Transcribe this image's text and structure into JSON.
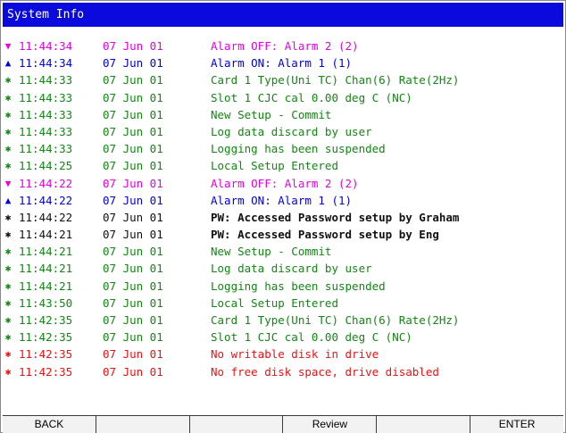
{
  "window": {
    "title": "System Info"
  },
  "colors": {
    "alarm_off": "#e600e6",
    "alarm_on": "#0000dd",
    "info": "#118811",
    "password": "#111111",
    "error": "#ee1111",
    "title_bg": "#0a0adc"
  },
  "log": [
    {
      "marker": "▼",
      "marker_icon": "triangle-down-icon",
      "time": "11:44:34",
      "date": "07 Jun 01",
      "message": "Alarm OFF: Alarm 2 (2)",
      "type": "alarm_off"
    },
    {
      "marker": "▲",
      "marker_icon": "triangle-up-icon",
      "time": "11:44:34",
      "date": "07 Jun 01",
      "message": "Alarm ON: Alarm 1 (1)",
      "type": "alarm_on"
    },
    {
      "marker": "✱",
      "marker_icon": "asterisk-icon",
      "time": "11:44:33",
      "date": "07 Jun 01",
      "message": "Card 1 Type(Uni TC) Chan(6) Rate(2Hz)",
      "type": "info"
    },
    {
      "marker": "✱",
      "marker_icon": "asterisk-icon",
      "time": "11:44:33",
      "date": "07 Jun 01",
      "message": "Slot 1 CJC cal 0.00 deg C (NC)",
      "type": "info"
    },
    {
      "marker": "✱",
      "marker_icon": "asterisk-icon",
      "time": "11:44:33",
      "date": "07 Jun 01",
      "message": "New Setup - Commit",
      "type": "info"
    },
    {
      "marker": "✱",
      "marker_icon": "asterisk-icon",
      "time": "11:44:33",
      "date": "07 Jun 01",
      "message": "Log data discard by user",
      "type": "info"
    },
    {
      "marker": "✱",
      "marker_icon": "asterisk-icon",
      "time": "11:44:33",
      "date": "07 Jun 01",
      "message": "Logging has been suspended",
      "type": "info"
    },
    {
      "marker": "✱",
      "marker_icon": "asterisk-icon",
      "time": "11:44:25",
      "date": "07 Jun 01",
      "message": "Local Setup Entered",
      "type": "info"
    },
    {
      "marker": "▼",
      "marker_icon": "triangle-down-icon",
      "time": "11:44:22",
      "date": "07 Jun 01",
      "message": "Alarm OFF: Alarm 2 (2)",
      "type": "alarm_off"
    },
    {
      "marker": "▲",
      "marker_icon": "triangle-up-icon",
      "time": "11:44:22",
      "date": "07 Jun 01",
      "message": "Alarm ON: Alarm 1 (1)",
      "type": "alarm_on"
    },
    {
      "marker": "✱",
      "marker_icon": "asterisk-icon",
      "time": "11:44:22",
      "date": "07 Jun 01",
      "message": "PW: Accessed Password setup by Graham",
      "type": "password"
    },
    {
      "marker": "✱",
      "marker_icon": "asterisk-icon",
      "time": "11:44:21",
      "date": "07 Jun 01",
      "message": "PW: Accessed Password setup by Eng",
      "type": "password"
    },
    {
      "marker": "✱",
      "marker_icon": "asterisk-icon",
      "time": "11:44:21",
      "date": "07 Jun 01",
      "message": "New Setup - Commit",
      "type": "info"
    },
    {
      "marker": "✱",
      "marker_icon": "asterisk-icon",
      "time": "11:44:21",
      "date": "07 Jun 01",
      "message": "Log data discard by user",
      "type": "info"
    },
    {
      "marker": "✱",
      "marker_icon": "asterisk-icon",
      "time": "11:44:21",
      "date": "07 Jun 01",
      "message": "Logging has been suspended",
      "type": "info"
    },
    {
      "marker": "✱",
      "marker_icon": "asterisk-icon",
      "time": "11:43:50",
      "date": "07 Jun 01",
      "message": "Local Setup Entered",
      "type": "info"
    },
    {
      "marker": "✱",
      "marker_icon": "asterisk-icon",
      "time": "11:42:35",
      "date": "07 Jun 01",
      "message": "Card 1 Type(Uni TC) Chan(6) Rate(2Hz)",
      "type": "info"
    },
    {
      "marker": "✱",
      "marker_icon": "asterisk-icon",
      "time": "11:42:35",
      "date": "07 Jun 01",
      "message": "Slot 1 CJC cal 0.00 deg C (NC)",
      "type": "info"
    },
    {
      "marker": "✱",
      "marker_icon": "asterisk-icon",
      "time": "11:42:35",
      "date": "07 Jun 01",
      "message": "No writable disk in drive",
      "type": "error"
    },
    {
      "marker": "✱",
      "marker_icon": "asterisk-icon",
      "time": "11:42:35",
      "date": "07 Jun 01",
      "message": "No free disk space, drive disabled",
      "type": "error"
    }
  ],
  "softkeys": [
    "BACK",
    "",
    "",
    "Review",
    "",
    "ENTER"
  ]
}
